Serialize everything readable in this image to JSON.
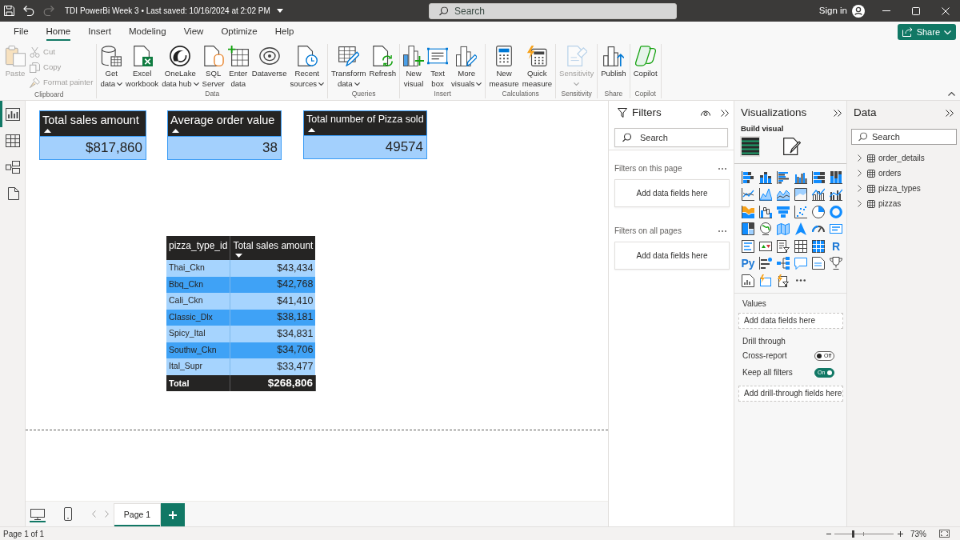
{
  "title_bar": {
    "quick_access": [
      {
        "kind": "save",
        "disabled": false
      },
      {
        "kind": "undo",
        "disabled": false
      },
      {
        "kind": "redo",
        "disabled": true
      }
    ],
    "title": "TDI PowerBi Week 3 • Last saved: 10/16/2024 at 2:02 PM",
    "search": {
      "placeholder": "Search"
    },
    "sign_in": "Sign in"
  },
  "menu_tabs": [
    {
      "label": "File",
      "selected": false
    },
    {
      "label": "Home",
      "selected": true
    },
    {
      "label": "Insert",
      "selected": false
    },
    {
      "label": "Modeling",
      "selected": false
    },
    {
      "label": "View",
      "selected": false
    },
    {
      "label": "Optimize",
      "selected": false
    },
    {
      "label": "Help",
      "selected": false
    }
  ],
  "share_button": {
    "label": "Share"
  },
  "ribbon": [
    {
      "group": "Clipboard",
      "items": [
        {
          "kind": "large",
          "lines": [
            "Paste"
          ],
          "dropdown": false,
          "disabled": true
        },
        {
          "kind": "small",
          "lines": [
            "Cut"
          ],
          "dropdown": false,
          "disabled": true
        },
        {
          "kind": "small",
          "lines": [
            "Copy"
          ],
          "dropdown": false,
          "disabled": true
        },
        {
          "kind": "small",
          "lines": [
            "Format painter"
          ],
          "dropdown": false,
          "disabled": true
        }
      ]
    },
    {
      "group": "Data",
      "items": [
        {
          "kind": "large",
          "lines": [
            "Get",
            "data"
          ],
          "dropdown": true,
          "disabled": false
        },
        {
          "kind": "large",
          "lines": [
            "Excel",
            "workbook"
          ],
          "dropdown": false,
          "disabled": false
        },
        {
          "kind": "large",
          "lines": [
            "OneLake",
            "data hub"
          ],
          "dropdown": true,
          "disabled": false
        },
        {
          "kind": "large",
          "lines": [
            "SQL",
            "Server"
          ],
          "dropdown": false,
          "disabled": false
        },
        {
          "kind": "large",
          "lines": [
            "Enter",
            "data"
          ],
          "dropdown": false,
          "disabled": false
        },
        {
          "kind": "large",
          "lines": [
            "Dataverse"
          ],
          "dropdown": false,
          "disabled": false
        },
        {
          "kind": "large",
          "lines": [
            "Recent",
            "sources"
          ],
          "dropdown": true,
          "disabled": false
        }
      ]
    },
    {
      "group": "Queries",
      "items": [
        {
          "kind": "large",
          "lines": [
            "Transform",
            "data"
          ],
          "dropdown": true,
          "disabled": false
        },
        {
          "kind": "large",
          "lines": [
            "Refresh"
          ],
          "dropdown": false,
          "disabled": false
        }
      ]
    },
    {
      "group": "Insert",
      "items": [
        {
          "kind": "large",
          "lines": [
            "New",
            "visual"
          ],
          "dropdown": false,
          "disabled": false
        },
        {
          "kind": "large",
          "lines": [
            "Text",
            "box"
          ],
          "dropdown": false,
          "disabled": false
        },
        {
          "kind": "large",
          "lines": [
            "More",
            "visuals"
          ],
          "dropdown": true,
          "disabled": false
        }
      ]
    },
    {
      "group": "Calculations",
      "items": [
        {
          "kind": "large",
          "lines": [
            "New",
            "measure"
          ],
          "dropdown": false,
          "disabled": false
        },
        {
          "kind": "large",
          "lines": [
            "Quick",
            "measure"
          ],
          "dropdown": false,
          "disabled": false
        }
      ]
    },
    {
      "group": "Sensitivity",
      "items": [
        {
          "kind": "large",
          "lines": [
            "Sensitivity"
          ],
          "dropdown": true,
          "disabled": true
        }
      ]
    },
    {
      "group": "Share",
      "items": [
        {
          "kind": "large",
          "lines": [
            "Publish"
          ],
          "dropdown": false,
          "disabled": false
        }
      ]
    },
    {
      "group": "Copilot",
      "items": [
        {
          "kind": "large",
          "lines": [
            "Copilot"
          ],
          "dropdown": false,
          "disabled": false
        }
      ]
    }
  ],
  "view_rail": [
    {
      "kind": "report",
      "selected": true
    },
    {
      "kind": "table",
      "selected": false
    },
    {
      "kind": "model",
      "selected": false
    },
    {
      "kind": "dax",
      "selected": false
    }
  ],
  "cards": [
    {
      "title": "Total sales amount",
      "sort_ascending": true,
      "value": "$817,860"
    },
    {
      "title": "Average order value",
      "sort_ascending": true,
      "value": "38"
    },
    {
      "title": "Total number of Pizza sold",
      "sort_ascending": true,
      "value": "49574"
    }
  ],
  "table": {
    "columns": [
      {
        "label": "pizza_type_id",
        "sort_descending": false
      },
      {
        "label": "Total sales amount",
        "sort_descending": true
      }
    ],
    "rows": [
      [
        "Thai_Ckn",
        "$43,434"
      ],
      [
        "Bbq_Ckn",
        "$42,768"
      ],
      [
        "Cali_Ckn",
        "$41,410"
      ],
      [
        "Classic_Dlx",
        "$38,181"
      ],
      [
        "Spicy_Ital",
        "$34,831"
      ],
      [
        "Southw_Ckn",
        "$34,706"
      ],
      [
        "Ital_Supr",
        "$33,477"
      ]
    ],
    "total": [
      "Total",
      "$268,806"
    ]
  },
  "filters": {
    "title": "Filters",
    "search": {
      "placeholder": "Search"
    },
    "sections": [
      {
        "label": "Filters on this page",
        "drop_zone": "Add data fields here"
      },
      {
        "label": "Filters on all pages",
        "drop_zone": "Add data fields here"
      }
    ]
  },
  "visualizations": {
    "title": "Visualizations",
    "build_label": "Build visual",
    "build_modes": [
      {
        "kind": "fields",
        "selected": true
      },
      {
        "kind": "format",
        "selected": false
      }
    ],
    "letter_visuals": [
      "R",
      "Py"
    ],
    "values_label": "Values",
    "values_drop_zone": "Add data fields here",
    "drill_through": {
      "title": "Drill through",
      "toggles": [
        {
          "label": "Cross-report",
          "on": false,
          "state_text": "Off"
        },
        {
          "label": "Keep all filters",
          "on": true,
          "state_text": "On"
        }
      ],
      "drop_zone": "Add drill-through fields here"
    }
  },
  "data": {
    "title": "Data",
    "search": {
      "placeholder": "Search"
    },
    "tables": [
      {
        "name": "order_details",
        "expanded": false
      },
      {
        "name": "orders",
        "expanded": false
      },
      {
        "name": "pizza_types",
        "expanded": false
      },
      {
        "name": "pizzas",
        "expanded": false
      }
    ]
  },
  "view_modes": [
    {
      "kind": "desktop",
      "selected": true
    },
    {
      "kind": "mobile",
      "selected": false
    }
  ],
  "pages": [
    {
      "label": "Page 1",
      "selected": true
    }
  ],
  "status_bar": {
    "page_info": "Page 1 of 1",
    "zoom": {
      "level": 0.31,
      "reading": "73%"
    }
  }
}
